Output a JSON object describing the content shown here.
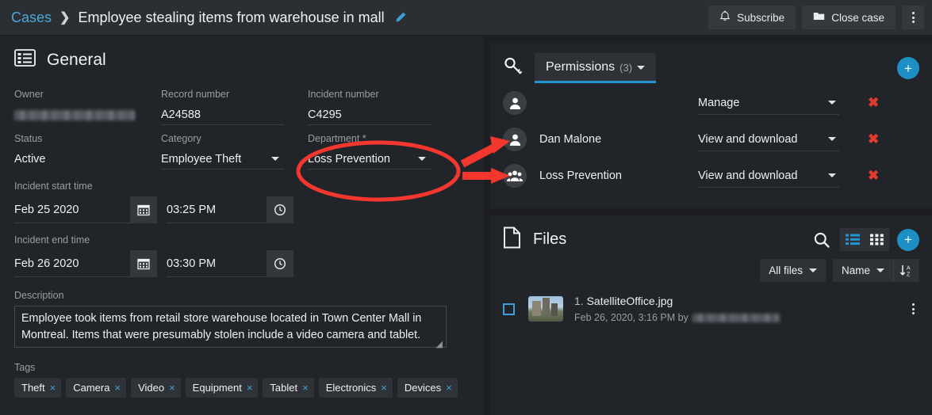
{
  "topbar": {
    "breadcrumb_root": "Cases",
    "breadcrumb_sep": "❯",
    "title": "Employee stealing items from warehouse in mall",
    "edit_icon": "pencil-icon",
    "subscribe_label": "Subscribe",
    "subscribe_icon": "bell-icon",
    "close_case_label": "Close case",
    "close_case_icon": "folder-icon",
    "overflow_icon": "more-vertical-icon"
  },
  "general": {
    "section_icon": "details-list-icon",
    "section_title": "General",
    "fields": {
      "owner_label": "Owner",
      "owner_value": "",
      "record_label": "Record number",
      "record_value": "A24588",
      "incident_label": "Incident number",
      "incident_value": "C4295",
      "status_label": "Status",
      "status_value": "Active",
      "category_label": "Category",
      "category_value": "Employee Theft",
      "department_label": "Department *",
      "department_value": "Loss Prevention"
    },
    "start": {
      "label": "Incident start time",
      "date": "Feb 25 2020",
      "time": "03:25 PM",
      "date_icon": "calendar-icon",
      "time_icon": "clock-icon"
    },
    "end": {
      "label": "Incident end time",
      "date": "Feb 26 2020",
      "time": "03:30 PM",
      "date_icon": "calendar-icon",
      "time_icon": "clock-icon"
    },
    "description_label": "Description",
    "description_value": "Employee took items from retail store warehouse located in Town Center Mall in Montreal. Items that were presumably stolen include a video camera and tablet.",
    "tags_label": "Tags",
    "tags": [
      "Theft",
      "Camera",
      "Video",
      "Equipment",
      "Tablet",
      "Electronics",
      "Devices"
    ],
    "tag_remove_glyph": "×"
  },
  "permissions": {
    "icon": "key-icon",
    "tab_label": "Permissions",
    "tab_count": "(3)",
    "add_label": "+",
    "rows": [
      {
        "name": "",
        "redacted": true,
        "avatar": "user-icon",
        "access": "Manage"
      },
      {
        "name": "Dan Malone",
        "redacted": false,
        "avatar": "user-icon",
        "access": "View and download"
      },
      {
        "name": "Loss Prevention",
        "redacted": false,
        "avatar": "group-icon",
        "access": "View and download"
      }
    ],
    "remove_glyph": "✖"
  },
  "files": {
    "icon": "file-icon",
    "title": "Files",
    "search_icon": "search-icon",
    "list_view_icon": "list-view-icon",
    "grid_view_icon": "grid-view-icon",
    "add_label": "+",
    "filter_label": "All files",
    "sort_field_label": "Name",
    "sort_dir_icon": "sort-az-icon",
    "items": [
      {
        "index": "1.",
        "name": "SatelliteOffice.jpg",
        "meta": "Feb 26, 2020, 3:16 PM by",
        "uploader_redacted": true,
        "menu_icon": "more-vertical-icon",
        "thumb": "building-photo"
      }
    ]
  },
  "annotation": {
    "highlight_color": "#f4372e",
    "shape": "ellipse-around-department-field",
    "arrows": 2
  }
}
